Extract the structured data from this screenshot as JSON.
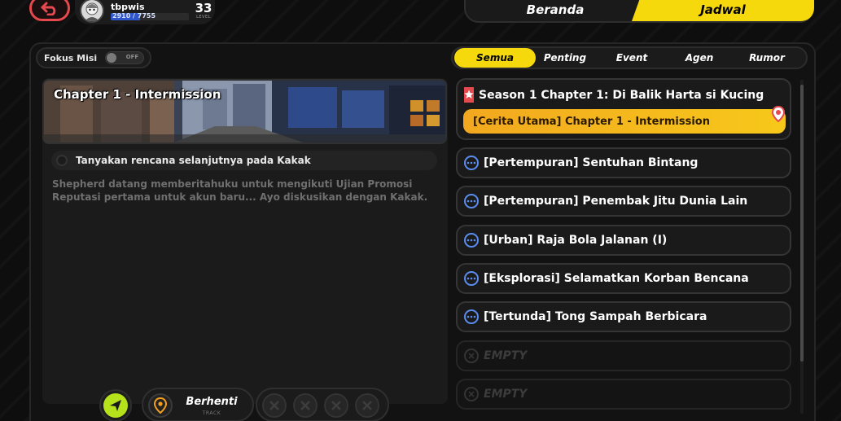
{
  "player": {
    "name": "tbpwis",
    "xp_text": "2910 / 7755",
    "xp_fraction": 0.375,
    "level": "33",
    "level_label": "LEVEL"
  },
  "top_tabs": [
    {
      "label": "Beranda",
      "active": false
    },
    {
      "label": "Jadwal",
      "active": true
    }
  ],
  "focus": {
    "label": "Fokus Misi",
    "toggle_text": "OFF"
  },
  "filters": [
    {
      "label": "Semua",
      "active": true
    },
    {
      "label": "Penting",
      "active": false
    },
    {
      "label": "Event",
      "active": false
    },
    {
      "label": "Agen",
      "active": false
    },
    {
      "label": "Rumor",
      "active": false
    }
  ],
  "detail": {
    "chapter_title": "Chapter 1 - Intermission",
    "objective": "Tanyakan rencana selanjutnya pada Kakak",
    "description": "Shepherd datang memberitahuku untuk mengikuti Ujian Promosi Reputasi pertama untuk akun baru... Ayo diskusikan dengan Kakak."
  },
  "controls": {
    "track_label": "Berhenti",
    "track_sub": "TRACK"
  },
  "missions": {
    "main": {
      "title": "Season 1 Chapter 1: Di Balik Harta si Kucing",
      "subtitle": "[Cerita Utama] Chapter 1 - Intermission"
    },
    "list": [
      {
        "title": "[Pertempuran] Sentuhan Bintang"
      },
      {
        "title": "[Pertempuran] Penembak Jitu Dunia Lain"
      },
      {
        "title": "[Urban] Raja Bola Jalanan (I)"
      },
      {
        "title": "[Eksplorasi] Selamatkan Korban Bencana"
      },
      {
        "title": "[Tertunda] Tong Sampah Berbicara"
      }
    ],
    "empty": [
      {
        "title": "EMPTY"
      },
      {
        "title": "EMPTY"
      }
    ]
  },
  "colors": {
    "accent_yellow": "#f5d90c",
    "main_orange": "#f2a81f",
    "back_red": "#e5484d",
    "nav_green": "#b5e21a",
    "mission_blue": "#5b8cf0"
  }
}
